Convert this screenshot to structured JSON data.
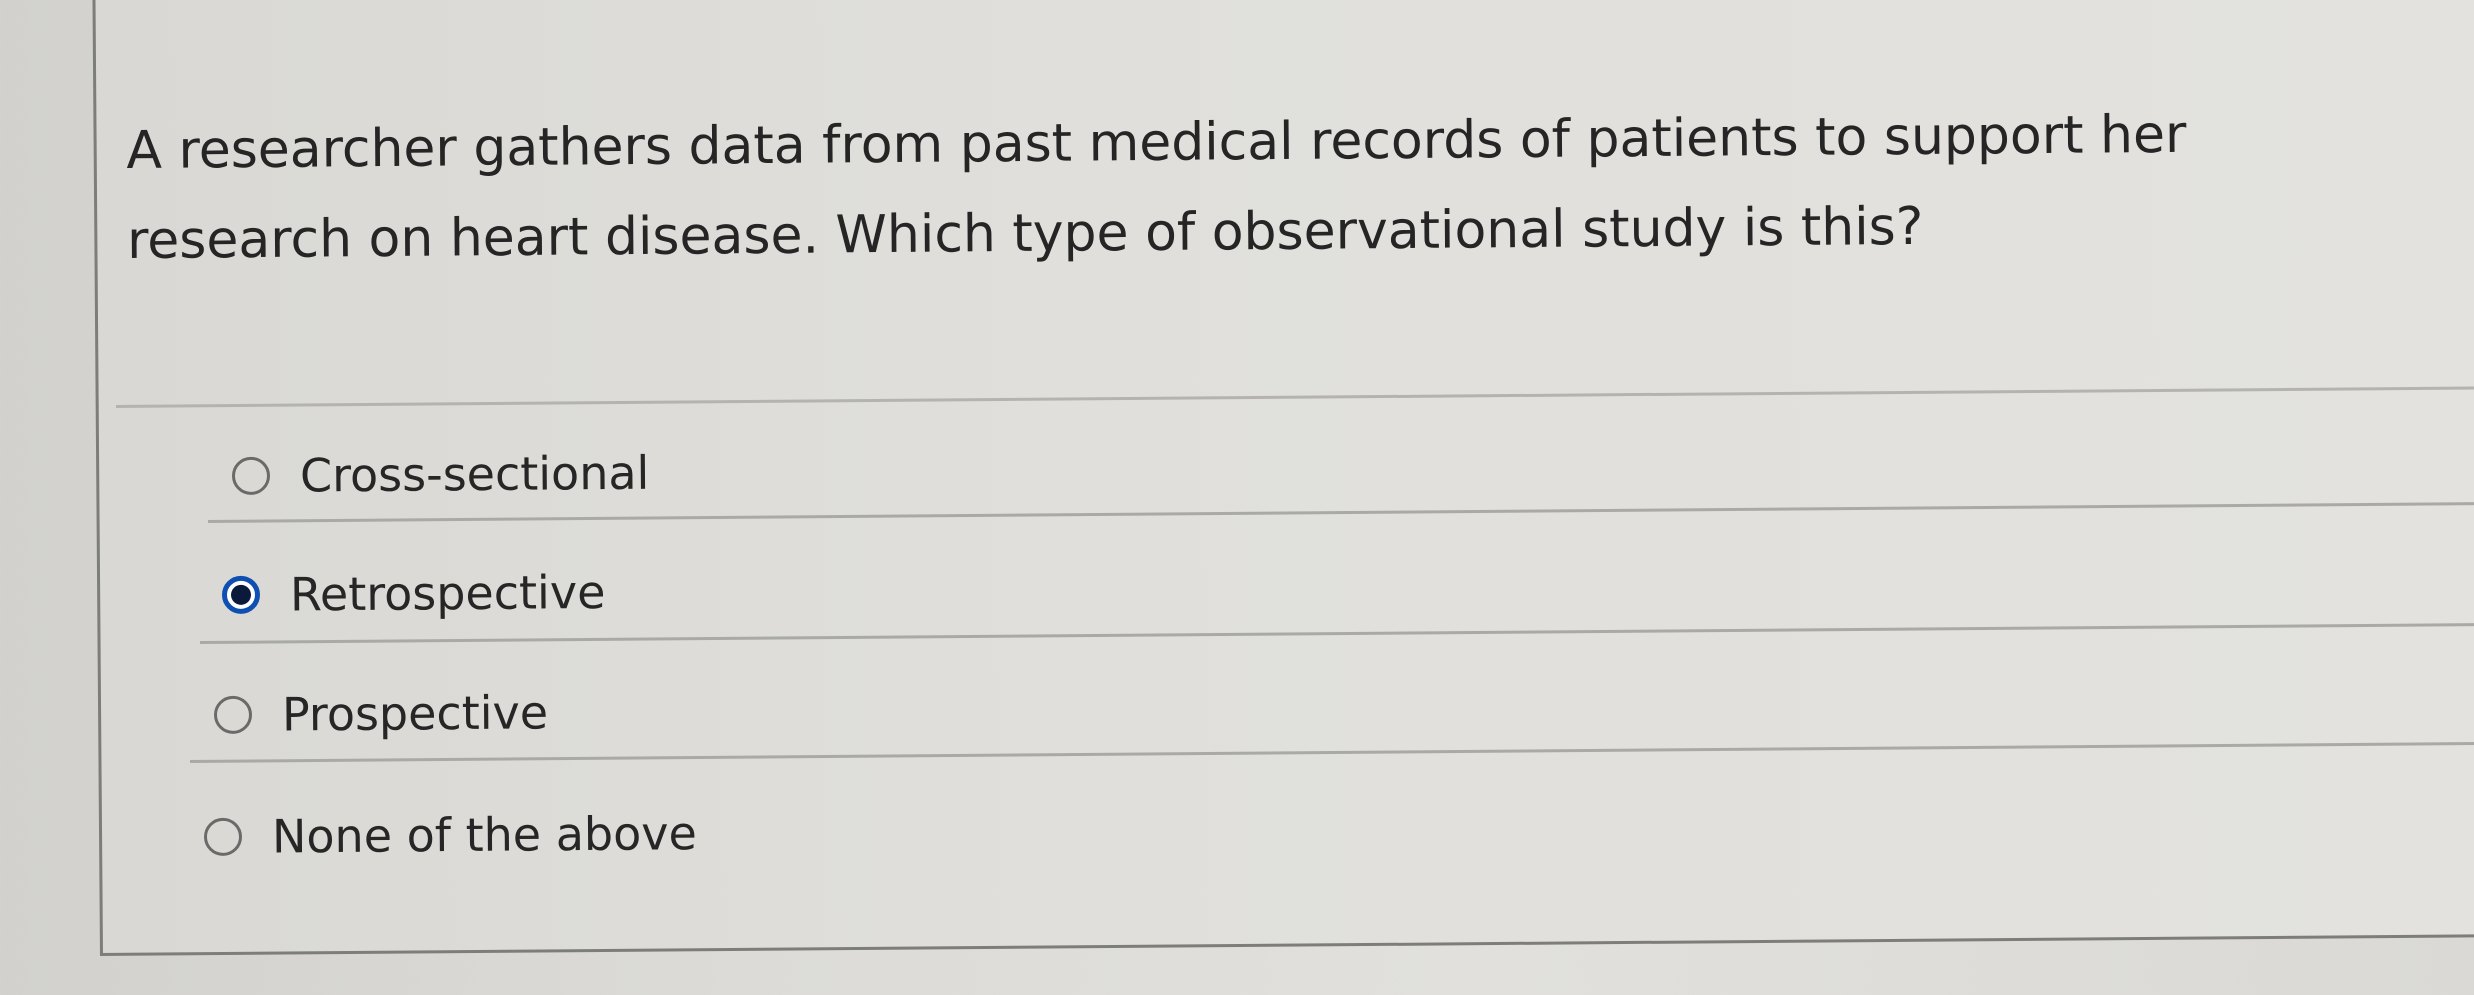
{
  "question": {
    "text": "A researcher gathers data from past medical records of patients to support her research on heart disease.  Which type of observational study is this?"
  },
  "answers": [
    {
      "label": "Cross-sectional",
      "selected": false
    },
    {
      "label": "Retrospective",
      "selected": true
    },
    {
      "label": "Prospective",
      "selected": false
    },
    {
      "label": "None of the above",
      "selected": false
    }
  ],
  "colors": {
    "selected_ring": "#0f4fb2",
    "selected_dot": "#0b1a3a",
    "text": "#262626",
    "background": "#e0dfdb"
  }
}
